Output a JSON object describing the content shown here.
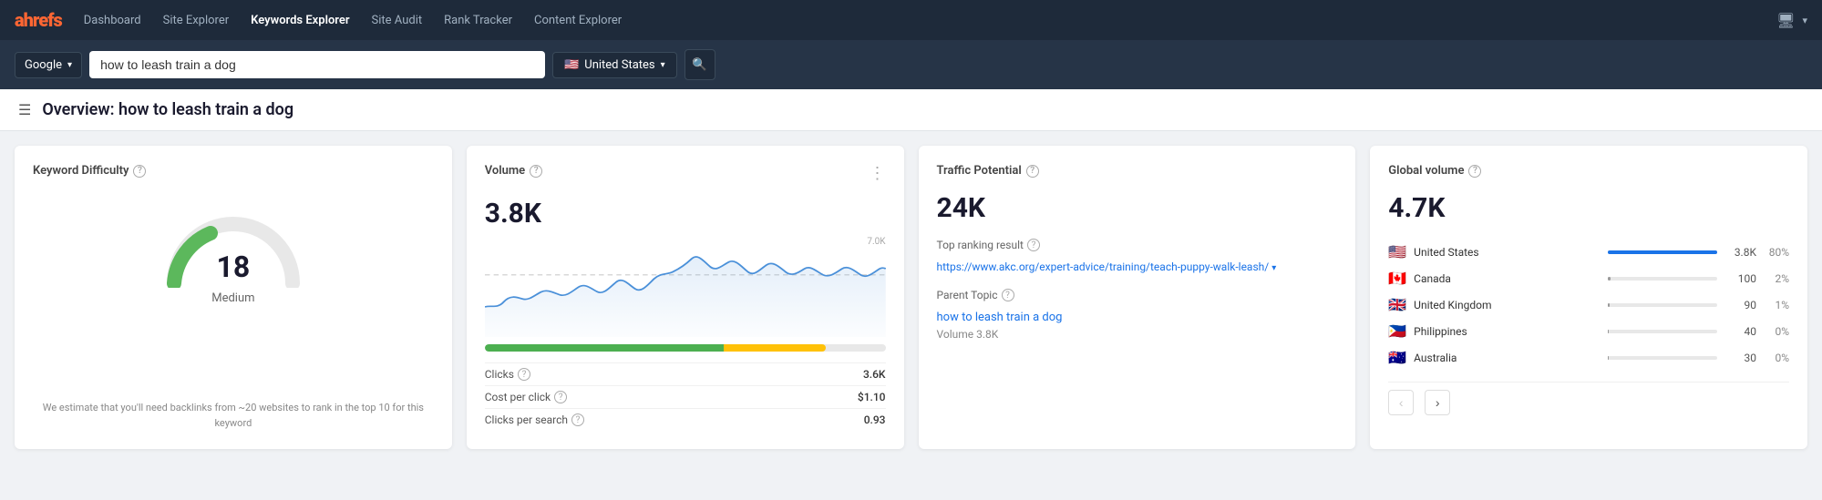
{
  "nav": {
    "logo": "ahrefs",
    "links": [
      {
        "label": "Dashboard",
        "active": false
      },
      {
        "label": "Site Explorer",
        "active": false
      },
      {
        "label": "Keywords Explorer",
        "active": true
      },
      {
        "label": "Site Audit",
        "active": false
      },
      {
        "label": "Rank Tracker",
        "active": false
      },
      {
        "label": "Content Explorer",
        "active": false
      }
    ]
  },
  "search": {
    "engine": "Google",
    "query": "how to leash train a dog",
    "country": "United States",
    "search_btn_icon": "🔍"
  },
  "page": {
    "title": "Overview: how to leash train a dog",
    "menu_icon": "☰"
  },
  "keyword_difficulty": {
    "title": "Keyword Difficulty",
    "value": 18,
    "label": "Medium",
    "footer": "We estimate that you'll need backlinks from ~20 websites\nto rank in the top 10 for this keyword"
  },
  "volume": {
    "title": "Volume",
    "value": "3.8K",
    "chart_max": "7.0K",
    "metrics": [
      {
        "label": "Clicks",
        "value": "3.6K"
      },
      {
        "label": "Cost per click",
        "value": "$1.10"
      },
      {
        "label": "Clicks per search",
        "value": "0.93"
      }
    ]
  },
  "traffic_potential": {
    "title": "Traffic Potential",
    "value": "24K",
    "top_ranking_label": "Top ranking result",
    "top_ranking_url": "https://www.akc.org/expert-advice/training/teach-puppy-walk-leash/",
    "parent_topic_label": "Parent Topic",
    "parent_topic_link": "how to leash train a dog",
    "volume_sub": "Volume 3.8K"
  },
  "global_volume": {
    "title": "Global volume",
    "value": "4.7K",
    "countries": [
      {
        "flag": "🇺🇸",
        "name": "United States",
        "count": "3.8K",
        "pct": "80%",
        "bar": 100
      },
      {
        "flag": "🇨🇦",
        "name": "Canada",
        "count": "100",
        "pct": "2%",
        "bar": 2.5
      },
      {
        "flag": "🇬🇧",
        "name": "United Kingdom",
        "count": "90",
        "pct": "1%",
        "bar": 2
      },
      {
        "flag": "🇵🇭",
        "name": "Philippines",
        "count": "40",
        "pct": "0%",
        "bar": 1
      },
      {
        "flag": "🇦🇺",
        "name": "Australia",
        "count": "30",
        "pct": "0%",
        "bar": 0.8
      }
    ],
    "prev_btn": "‹",
    "next_btn": "›"
  }
}
